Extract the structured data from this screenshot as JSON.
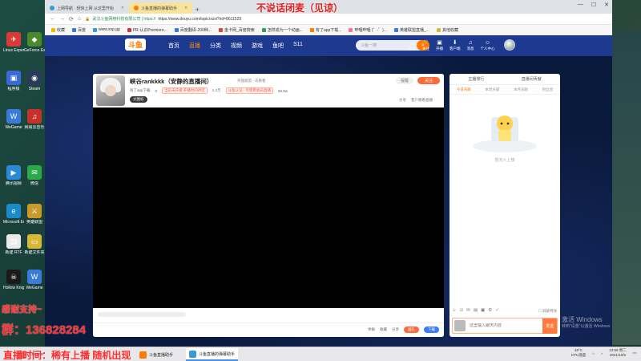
{
  "overlays": {
    "top": "不说话闭麦（见谅）",
    "left1": "感谢支持~",
    "left2": "群：136828284",
    "bottom": "直播时间：稀有上播 随机出现"
  },
  "desktop_icons": [
    {
      "label": "Linux Expert",
      "color": "#d83a3a",
      "glyph": "✈"
    },
    {
      "label": "GeForce Experience",
      "color": "#4a8a2a",
      "glyph": "◆"
    },
    {
      "label": "程序猿",
      "color": "#3a6ad8",
      "glyph": "▣"
    },
    {
      "label": "Steam",
      "color": "#2a3a5a",
      "glyph": "◉"
    },
    {
      "label": "WeGame",
      "color": "#3a7ad8",
      "glyph": "W"
    },
    {
      "label": "网易云音乐",
      "color": "#c8302a",
      "glyph": "♫"
    },
    {
      "label": "腾讯视频",
      "color": "#2a8ad8",
      "glyph": "▶"
    },
    {
      "label": "微信",
      "color": "#2aa84a",
      "glyph": "✉"
    },
    {
      "label": "Microsoft Edge",
      "color": "#1a8ac8",
      "glyph": "e"
    },
    {
      "label": "英雄联盟",
      "color": "#c89a2a",
      "glyph": "⚔"
    },
    {
      "label": "新建 RTF",
      "color": "#eaeaea",
      "glyph": "▤"
    },
    {
      "label": "新建文件夹",
      "color": "#d8b83a",
      "glyph": "▭"
    },
    {
      "label": "Hollow Knight",
      "color": "#1a1a1a",
      "glyph": "☠"
    },
    {
      "label": "WeGame",
      "color": "#3a7ad8",
      "glyph": "W"
    }
  ],
  "browser": {
    "tabs": [
      {
        "title": "上网导航 · 轻快上网 从这里开始",
        "color": "#3a9ad8"
      },
      {
        "title": "斗鱼直播的弹幕助手",
        "color": "#ff7a00"
      }
    ],
    "nav_buttons": [
      "←",
      "→",
      "⟳",
      "⌂"
    ],
    "url_company": "武汉斗鱼网络科技有限公司 | https://",
    "url": "https://www.douyu.com/topic/xzxi?rid=8611529",
    "bookmarks": [
      "收藏",
      "百度",
      "www.xsp.gg",
      "PR-认识Premiere...",
      "百度翻译-200种...",
      "金卡网_百度搜索",
      "怎样成为一个动画...",
      "有了app下载...",
      "哔哩哔哩 (゜-゜)...",
      "英雄联盟直播_...",
      "其他收藏"
    ]
  },
  "douyu": {
    "logo": "斗鱼",
    "menu": [
      "首页",
      "直播",
      "分类",
      "视频",
      "游戏",
      "鱼吧",
      "S11"
    ],
    "search_placeholder": "斗鱼一搜",
    "header_icons": [
      "历史",
      "关注",
      "开播",
      "客户端",
      "消息",
      "个人中心"
    ],
    "room": {
      "title": "峡谷rankkkk（安静的直播间）",
      "category": "英雄联盟 · 去看看",
      "streamer": "有了app下载",
      "hot": "0",
      "badge1": "当前未开播 开播时间待定",
      "fans": "1.2万",
      "badge2": "斗鱼认证 · 可使用会员直播",
      "level": "59.9w",
      "tag": "大图标",
      "follow": "关注",
      "bell": "提醒",
      "actions": [
        "分享",
        "客户端看直播"
      ]
    },
    "footer": [
      "举报",
      "收藏",
      "分享",
      "送礼",
      "下载"
    ],
    "side": {
      "top": [
        "主播排行",
        "直播间贡献"
      ],
      "tabs": [
        "今日贡献",
        "本周贡献",
        "本月贡献",
        "粉丝团"
      ],
      "empty": "暂无人上榜",
      "chat_tools": [
        "☺",
        "⊙",
        "✉",
        "▤",
        "▣",
        "⚙",
        "✓"
      ],
      "chat_check": "屏蔽特效",
      "chat_placeholder": "这里输入聊天内容",
      "send": "发送"
    },
    "watermark_line1": "激活 Windows",
    "watermark_line2": "转到\"设置\"以激活 Windows"
  },
  "taskbar": {
    "items": [
      "Chrome",
      "斗鱼直播助手",
      "斗鱼直播的弹幕助手"
    ],
    "temp": "48°C",
    "temp_label": "CPU温度",
    "time": "13:59 周二",
    "date": "2021/10/5"
  }
}
